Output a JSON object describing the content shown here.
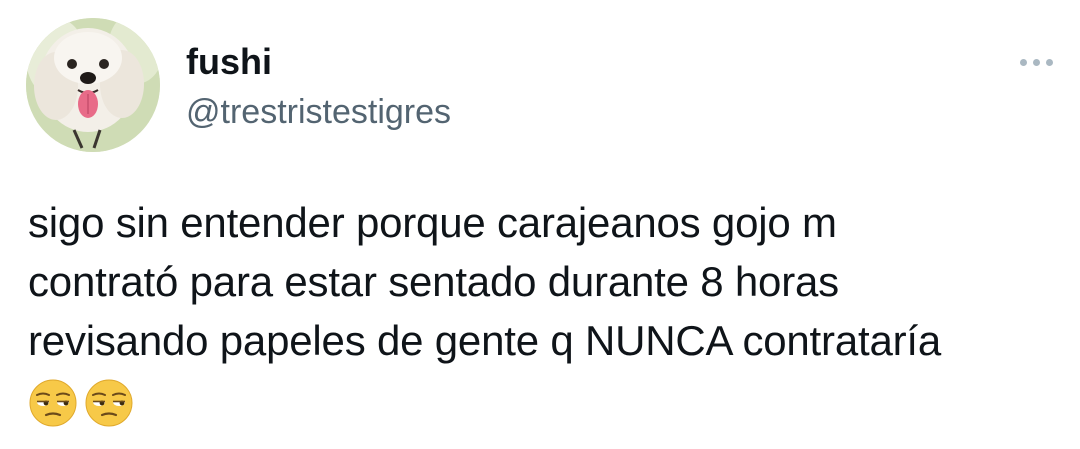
{
  "user": {
    "display_name": "fushi",
    "handle": "@trestristestigres",
    "avatar_icon": "avatar-white-dog"
  },
  "menu": {
    "icon": "more-dots-icon"
  },
  "tweet": {
    "lines": [
      "sigo sin entender porque carajeanos gojo m",
      "contrató para estar sentado durante 8 horas",
      "revisando papeles de gente q NUNCA contrataría"
    ],
    "emojis": [
      "unamused-face",
      "unamused-face"
    ]
  },
  "colors": {
    "text": "#0f1419",
    "secondary": "#536471",
    "menu_dots": "#aab8c2",
    "emoji_yellow": "#f7c948"
  }
}
